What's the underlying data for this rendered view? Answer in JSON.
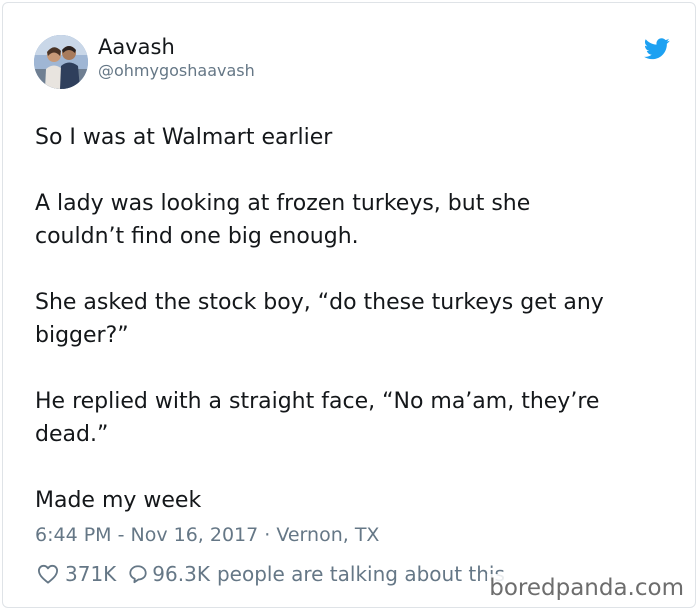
{
  "author": {
    "display_name": "Aavash",
    "handle": "@ohmygoshaavash",
    "avatar_icon": "profile-photo"
  },
  "brand": {
    "icon": "twitter-bird-icon",
    "color": "#1da1f2"
  },
  "tweet": {
    "lines": [
      "So I was at Walmart earlier",
      "A lady was looking at frozen turkeys, but she",
      "couldn’t find one big enough.",
      "She asked the stock boy, “do these turkeys get any",
      "bigger?”",
      "He replied with a straight face, “No ma’am, they’re",
      "dead.”",
      "Made my week"
    ]
  },
  "meta": {
    "time": "6:44 PM",
    "date": "Nov 16, 2017",
    "location": "Vernon, TX",
    "text": "6:44 PM - Nov 16, 2017 · Vernon, TX"
  },
  "engagement": {
    "likes": "371K",
    "replies": "96.3K",
    "replies_suffix": "people are talking about this",
    "like_icon": "heart-icon",
    "reply_icon": "speech-bubble-icon"
  },
  "watermark": {
    "text": "boredpanda.com"
  }
}
